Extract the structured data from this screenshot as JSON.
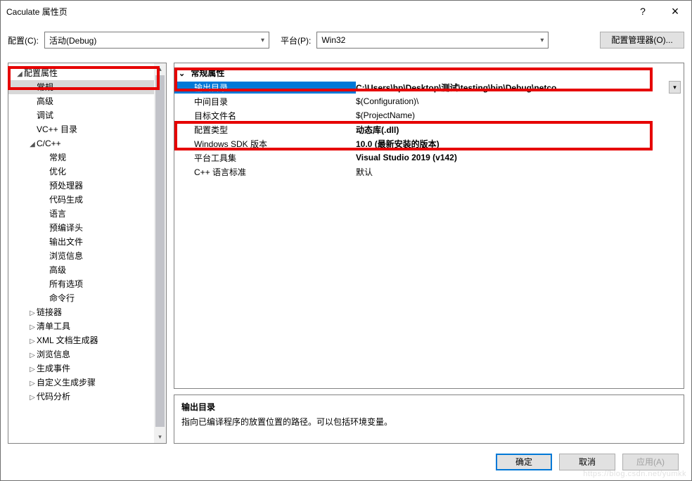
{
  "window": {
    "title": "Caculate 属性页",
    "help": "?",
    "close": "×"
  },
  "toolbar": {
    "config_label": "配置(C):",
    "config_value": "活动(Debug)",
    "platform_label": "平台(P):",
    "platform_value": "Win32",
    "config_manager": "配置管理器(O)..."
  },
  "tree": {
    "items": [
      {
        "label": "配置属性",
        "depth": 0,
        "exp": "◢",
        "sel": false
      },
      {
        "label": "常规",
        "depth": 1,
        "exp": "",
        "sel": true
      },
      {
        "label": "高级",
        "depth": 1,
        "exp": "",
        "sel": false
      },
      {
        "label": "调试",
        "depth": 1,
        "exp": "",
        "sel": false
      },
      {
        "label": "VC++ 目录",
        "depth": 1,
        "exp": "",
        "sel": false
      },
      {
        "label": "C/C++",
        "depth": 1,
        "exp": "◢",
        "sel": false
      },
      {
        "label": "常规",
        "depth": 2,
        "exp": "",
        "sel": false
      },
      {
        "label": "优化",
        "depth": 2,
        "exp": "",
        "sel": false
      },
      {
        "label": "预处理器",
        "depth": 2,
        "exp": "",
        "sel": false
      },
      {
        "label": "代码生成",
        "depth": 2,
        "exp": "",
        "sel": false
      },
      {
        "label": "语言",
        "depth": 2,
        "exp": "",
        "sel": false
      },
      {
        "label": "预编译头",
        "depth": 2,
        "exp": "",
        "sel": false
      },
      {
        "label": "输出文件",
        "depth": 2,
        "exp": "",
        "sel": false
      },
      {
        "label": "浏览信息",
        "depth": 2,
        "exp": "",
        "sel": false
      },
      {
        "label": "高级",
        "depth": 2,
        "exp": "",
        "sel": false
      },
      {
        "label": "所有选项",
        "depth": 2,
        "exp": "",
        "sel": false
      },
      {
        "label": "命令行",
        "depth": 2,
        "exp": "",
        "sel": false
      },
      {
        "label": "链接器",
        "depth": 1,
        "exp": "▷",
        "sel": false
      },
      {
        "label": "清单工具",
        "depth": 1,
        "exp": "▷",
        "sel": false
      },
      {
        "label": "XML 文档生成器",
        "depth": 1,
        "exp": "▷",
        "sel": false
      },
      {
        "label": "浏览信息",
        "depth": 1,
        "exp": "▷",
        "sel": false
      },
      {
        "label": "生成事件",
        "depth": 1,
        "exp": "▷",
        "sel": false
      },
      {
        "label": "自定义生成步骤",
        "depth": 1,
        "exp": "▷",
        "sel": false
      },
      {
        "label": "代码分析",
        "depth": 1,
        "exp": "▷",
        "sel": false
      }
    ]
  },
  "grid": {
    "section": "常规属性",
    "rows": [
      {
        "label": "输出目录",
        "value": "C:\\Users\\hp\\Desktop\\测试\\testing\\bin\\Debug\\netco",
        "selected": true,
        "bold": true
      },
      {
        "label": "中间目录",
        "value": "$(Configuration)\\",
        "bold": false
      },
      {
        "label": "目标文件名",
        "value": "$(ProjectName)",
        "bold": false
      },
      {
        "label": "配置类型",
        "value": "动态库(.dll)",
        "bold": true
      },
      {
        "label": "Windows SDK 版本",
        "value": "10.0 (最新安装的版本)",
        "bold": true
      },
      {
        "label": "平台工具集",
        "value": "Visual Studio 2019 (v142)",
        "bold": true
      },
      {
        "label": "C++ 语言标准",
        "value": "默认",
        "bold": false
      }
    ]
  },
  "description": {
    "title": "输出目录",
    "text": "指向已编译程序的放置位置的路径。可以包括环境变量。"
  },
  "footer": {
    "ok": "确定",
    "cancel": "取消",
    "apply": "应用(A)"
  },
  "watermark": "https://blog.csdn.net/yumkk"
}
